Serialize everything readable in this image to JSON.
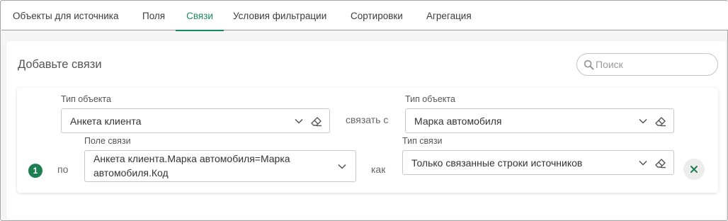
{
  "tabs": [
    {
      "label": "Объекты для источника",
      "active": false
    },
    {
      "label": "Поля",
      "active": false
    },
    {
      "label": "Связи",
      "active": true
    },
    {
      "label": "Условия фильтрации",
      "active": false
    },
    {
      "label": "Сортировки",
      "active": false
    },
    {
      "label": "Агрегация",
      "active": false
    }
  ],
  "panel": {
    "title": "Добавьте связи",
    "search": {
      "placeholder": "Поиск",
      "value": ""
    }
  },
  "link": {
    "number": "1",
    "left_object": {
      "label": "Тип объекта",
      "value": "Анкета клиента"
    },
    "connect_text": "связать с",
    "right_object": {
      "label": "Тип объекта",
      "value": "Марка автомобиля"
    },
    "by_text": "по",
    "link_field": {
      "label": "Поле связи",
      "value_line1": "Анкета клиента.Марка автомобиля=Марка",
      "value_line2": "автомобиля.Код"
    },
    "as_text": "как",
    "link_type": {
      "label": "Тип связи",
      "value": "Только связанные строки источников"
    }
  },
  "colors": {
    "accent": "#1b8a5a",
    "badge": "#1e7f52",
    "remove_icon": "#1e7f52"
  },
  "icons": [
    "search-icon",
    "chevron-down-icon",
    "eraser-icon",
    "close-icon"
  ]
}
